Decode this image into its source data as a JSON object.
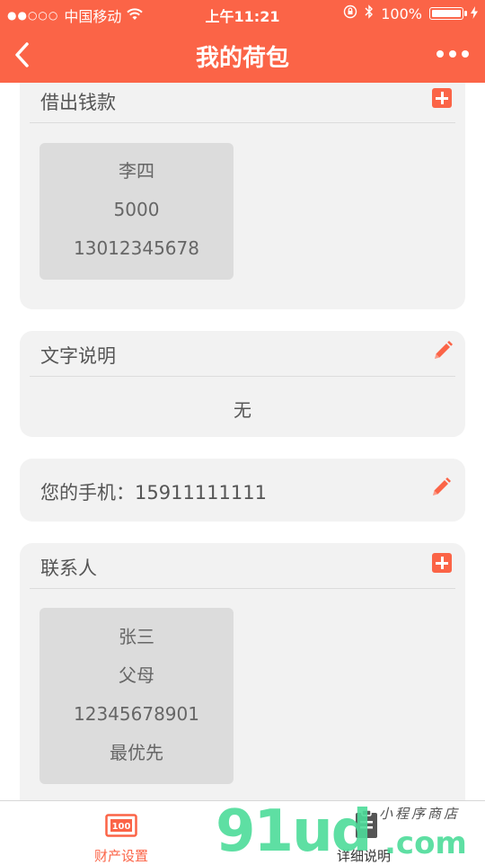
{
  "status_bar": {
    "signal": "●●○○○",
    "carrier": "中国移动",
    "time": "上午11:21",
    "battery": "100%"
  },
  "nav": {
    "title": "我的荷包"
  },
  "lend_card": {
    "title": "借出钱款",
    "entry": {
      "name": "李四",
      "amount": "5000",
      "phone": "13012345678"
    }
  },
  "note_card": {
    "title": "文字说明",
    "value": "无"
  },
  "phone_card": {
    "label": "您的手机：15911111111"
  },
  "contact_card": {
    "title": "联系人",
    "entry": {
      "name": "张三",
      "relation": "父母",
      "phone": "12345678901",
      "priority": "最优先"
    }
  },
  "tabs": [
    {
      "label": "财产设置",
      "icon": "money-icon",
      "active": true
    },
    {
      "label": "详细说明",
      "icon": "document-icon",
      "active": false
    }
  ],
  "watermark": {
    "main": "91ud",
    "sub": ".com",
    "script": "小程序商店"
  },
  "colors": {
    "brand": "#fb6447",
    "card_bg": "#f2f2f2",
    "tile_bg": "#dcdcdc"
  }
}
